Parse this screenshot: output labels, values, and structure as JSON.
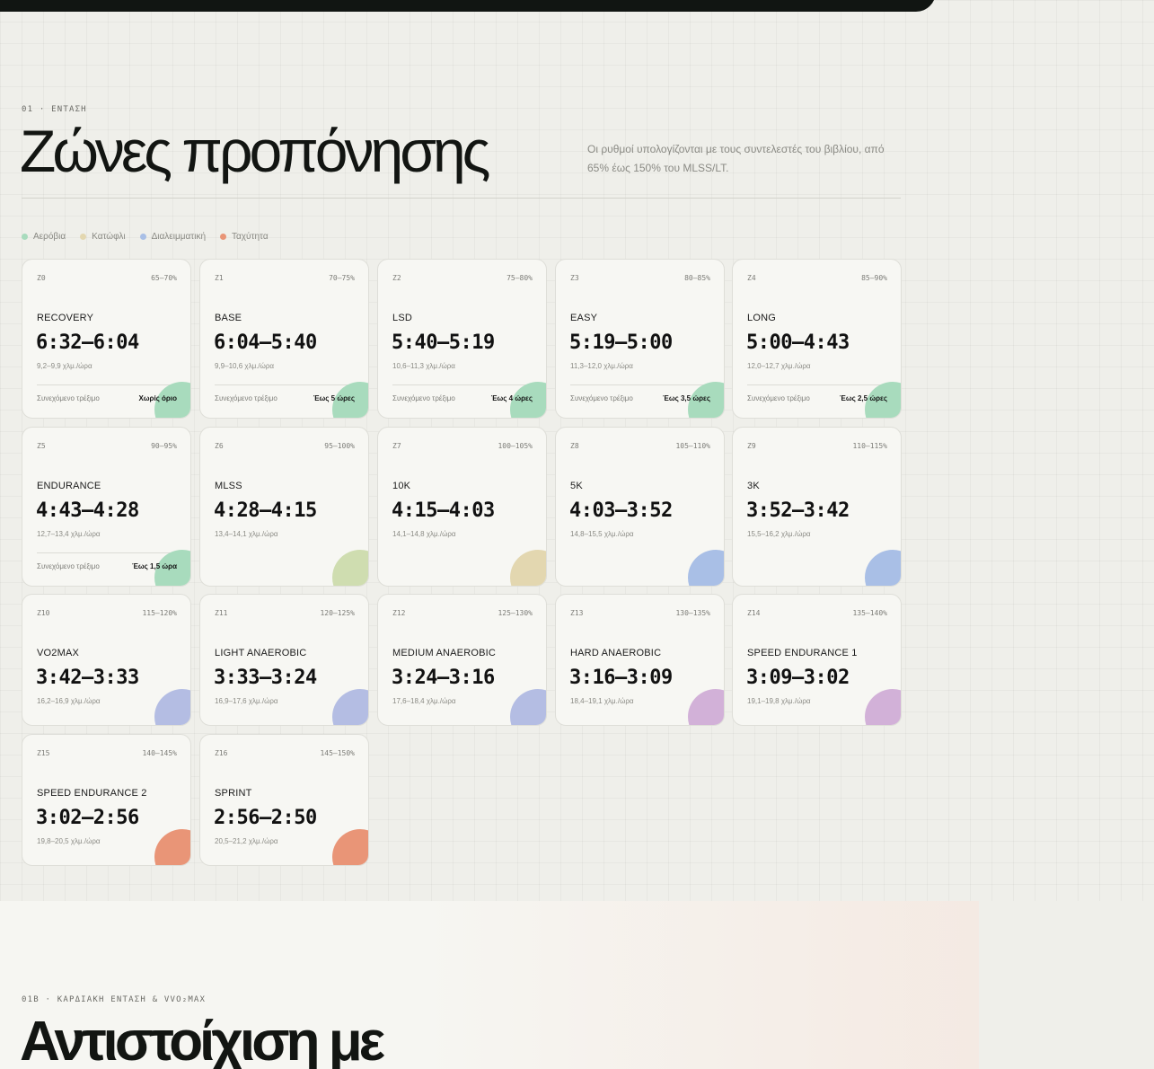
{
  "section": {
    "eyebrow": "01 · ΕΝΤΑΣΗ",
    "title": "Ζώνες προπόνησης",
    "subtitle": "Οι ρυθμοί υπολογίζονται με τους συντελεστές του βιβλίου, από 65% έως 150% του MLSS/LT."
  },
  "legend": [
    {
      "label": "Αερόβια",
      "color": "#a8dbbd"
    },
    {
      "label": "Κατώφλι",
      "color": "#e3d7b0"
    },
    {
      "label": "Διαλειμματική",
      "color": "#a9bfe6"
    },
    {
      "label": "Ταχύτητα",
      "color": "#e99577"
    }
  ],
  "zones": [
    {
      "code": "Z0",
      "range": "65–70%",
      "name": "RECOVERY",
      "pace": "6:32–6:04",
      "speed": "9,2–9,9 χλμ./ώρα",
      "note_label": "Συνεχόμενο τρέξιμο",
      "note_value": "Χωρίς όριο",
      "color": "#a8dbbd"
    },
    {
      "code": "Z1",
      "range": "70–75%",
      "name": "BASE",
      "pace": "6:04–5:40",
      "speed": "9,9–10,6 χλμ./ώρα",
      "note_label": "Συνεχόμενο τρέξιμο",
      "note_value": "Έως 5 ώρες",
      "color": "#a8dbbd"
    },
    {
      "code": "Z2",
      "range": "75–80%",
      "name": "LSD",
      "pace": "5:40–5:19",
      "speed": "10,6–11,3 χλμ./ώρα",
      "note_label": "Συνεχόμενο τρέξιμο",
      "note_value": "Έως 4 ώρες",
      "color": "#a8dbbd"
    },
    {
      "code": "Z3",
      "range": "80–85%",
      "name": "EASY",
      "pace": "5:19–5:00",
      "speed": "11,3–12,0 χλμ./ώρα",
      "note_label": "Συνεχόμενο τρέξιμο",
      "note_value": "Έως 3,5 ώρες",
      "color": "#a8dbbd"
    },
    {
      "code": "Z4",
      "range": "85–90%",
      "name": "LONG",
      "pace": "5:00–4:43",
      "speed": "12,0–12,7 χλμ./ώρα",
      "note_label": "Συνεχόμενο τρέξιμο",
      "note_value": "Έως 2,5 ώρες",
      "color": "#a8dbbd"
    },
    {
      "code": "Z5",
      "range": "90–95%",
      "name": "ENDURANCE",
      "pace": "4:43–4:28",
      "speed": "12,7–13,4 χλμ./ώρα",
      "note_label": "Συνεχόμενο τρέξιμο",
      "note_value": "Έως 1,5 ώρα",
      "color": "#a8dbbd"
    },
    {
      "code": "Z6",
      "range": "95–100%",
      "name": "MLSS",
      "pace": "4:28–4:15",
      "speed": "13,4–14,1 χλμ./ώρα",
      "color": "#cfddb0"
    },
    {
      "code": "Z7",
      "range": "100–105%",
      "name": "10K",
      "pace": "4:15–4:03",
      "speed": "14,1–14,8 χλμ./ώρα",
      "color": "#e3d7b0"
    },
    {
      "code": "Z8",
      "range": "105–110%",
      "name": "5K",
      "pace": "4:03–3:52",
      "speed": "14,8–15,5 χλμ./ώρα",
      "color": "#a9bfe6"
    },
    {
      "code": "Z9",
      "range": "110–115%",
      "name": "3K",
      "pace": "3:52–3:42",
      "speed": "15,5–16,2 χλμ./ώρα",
      "color": "#a9bfe6"
    },
    {
      "code": "Z10",
      "range": "115–120%",
      "name": "VO2MAX",
      "pace": "3:42–3:33",
      "speed": "16,2–16,9 χλμ./ώρα",
      "color": "#b4bde3"
    },
    {
      "code": "Z11",
      "range": "120–125%",
      "name": "LIGHT ANAEROBIC",
      "pace": "3:33–3:24",
      "speed": "16,9–17,6 χλμ./ώρα",
      "color": "#b4bde3"
    },
    {
      "code": "Z12",
      "range": "125–130%",
      "name": "MEDIUM ANAEROBIC",
      "pace": "3:24–3:16",
      "speed": "17,6–18,4 χλμ./ώρα",
      "color": "#b4bde3"
    },
    {
      "code": "Z13",
      "range": "130–135%",
      "name": "HARD ANAEROBIC",
      "pace": "3:16–3:09",
      "speed": "18,4–19,1 χλμ./ώρα",
      "color": "#d2b1d8"
    },
    {
      "code": "Z14",
      "range": "135–140%",
      "name": "SPEED ENDURANCE 1",
      "pace": "3:09–3:02",
      "speed": "19,1–19,8 χλμ./ώρα",
      "color": "#d2b1d8"
    },
    {
      "code": "Z15",
      "range": "140–145%",
      "name": "SPEED ENDURANCE 2",
      "pace": "3:02–2:56",
      "speed": "19,8–20,5 χλμ./ώρα",
      "color": "#e99577"
    },
    {
      "code": "Z16",
      "range": "145–150%",
      "name": "SPRINT",
      "pace": "2:56–2:50",
      "speed": "20,5–21,2 χλμ./ώρα",
      "color": "#e99577"
    }
  ],
  "section2": {
    "eyebrow": "01B · ΚΑΡΔΙΑΚΗ ΕΝΤΑΣΗ & VVO₂MAX",
    "title": "Αντιστοίχιση με"
  }
}
